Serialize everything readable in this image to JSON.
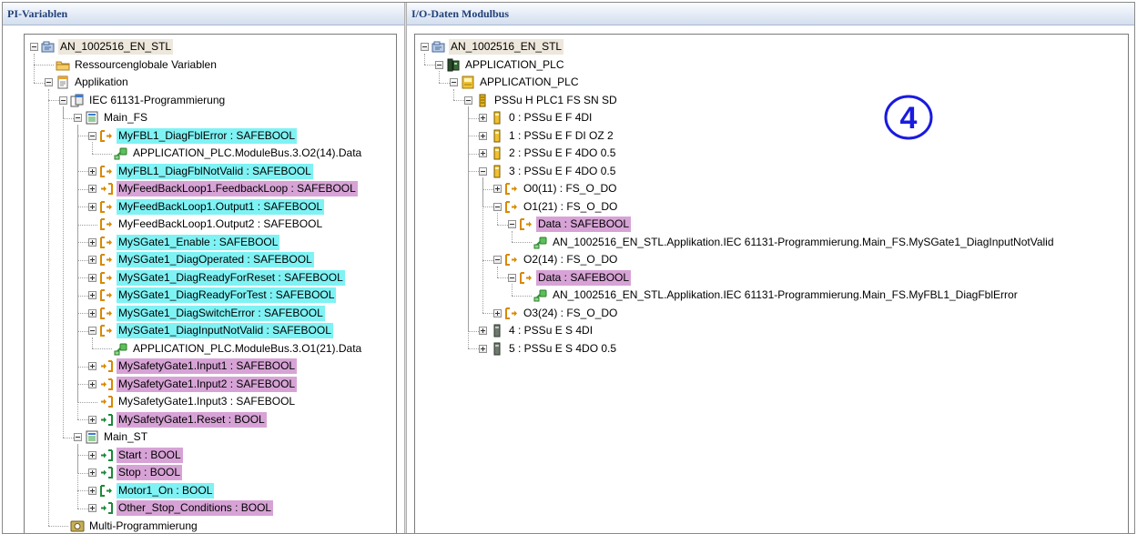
{
  "left_panel": {
    "title": "PI-Variablen",
    "tree": [
      {
        "label": "AN_1002516_EN_STL",
        "icon": "project-icon",
        "hl": "root",
        "exp": "minus"
      },
      {
        "label": "Ressourcenglobale Variablen",
        "icon": "folder-icon",
        "hl": "",
        "exp": "none"
      },
      {
        "label": "Applikation",
        "icon": "application-icon",
        "hl": "",
        "exp": "minus"
      },
      {
        "label": "IEC 61131-Programmierung",
        "icon": "program-group-icon",
        "hl": "",
        "exp": "minus"
      },
      {
        "label": "Main_FS",
        "icon": "program-icon",
        "hl": "",
        "exp": "minus"
      },
      {
        "label": "MyFBL1_DiagFblError : SAFEBOOL",
        "icon": "output-var-icon",
        "hl": "cyan",
        "exp": "minus"
      },
      {
        "label": "APPLICATION_PLC.ModuleBus.3.O2(14).Data",
        "icon": "link-icon",
        "hl": "",
        "exp": "none"
      },
      {
        "label": "MyFBL1_DiagFblNotValid : SAFEBOOL",
        "icon": "output-var-icon",
        "hl": "cyan",
        "exp": "plus"
      },
      {
        "label": "MyFeedBackLoop1.FeedbackLoop : SAFEBOOL",
        "icon": "input-var-icon",
        "hl": "mag",
        "exp": "plus"
      },
      {
        "label": "MyFeedBackLoop1.Output1 : SAFEBOOL",
        "icon": "output-var-icon",
        "hl": "cyan",
        "exp": "plus"
      },
      {
        "label": "MyFeedBackLoop1.Output2 : SAFEBOOL",
        "icon": "output-var-icon",
        "hl": "",
        "exp": "none"
      },
      {
        "label": "MySGate1_Enable : SAFEBOOL",
        "icon": "output-var-icon",
        "hl": "cyan",
        "exp": "plus"
      },
      {
        "label": "MySGate1_DiagOperated : SAFEBOOL",
        "icon": "output-var-icon",
        "hl": "cyan",
        "exp": "plus"
      },
      {
        "label": "MySGate1_DiagReadyForReset : SAFEBOOL",
        "icon": "output-var-icon",
        "hl": "cyan",
        "exp": "plus"
      },
      {
        "label": "MySGate1_DiagReadyForTest : SAFEBOOL",
        "icon": "output-var-icon",
        "hl": "cyan",
        "exp": "plus"
      },
      {
        "label": "MySGate1_DiagSwitchError : SAFEBOOL",
        "icon": "output-var-icon",
        "hl": "cyan",
        "exp": "plus"
      },
      {
        "label": "MySGate1_DiagInputNotValid : SAFEBOOL",
        "icon": "output-var-icon",
        "hl": "cyan",
        "exp": "minus"
      },
      {
        "label": "APPLICATION_PLC.ModuleBus.3.O1(21).Data",
        "icon": "link-icon",
        "hl": "",
        "exp": "none"
      },
      {
        "label": "MySafetyGate1.Input1 : SAFEBOOL",
        "icon": "input-var-icon",
        "hl": "mag",
        "exp": "plus"
      },
      {
        "label": "MySafetyGate1.Input2 : SAFEBOOL",
        "icon": "input-var-icon",
        "hl": "mag",
        "exp": "plus"
      },
      {
        "label": "MySafetyGate1.Input3 : SAFEBOOL",
        "icon": "input-var-icon",
        "hl": "",
        "exp": "none"
      },
      {
        "label": "MySafetyGate1.Reset : BOOL",
        "icon": "input-var-std-icon",
        "hl": "mag",
        "exp": "plus"
      },
      {
        "label": "Main_ST",
        "icon": "program-icon",
        "hl": "",
        "exp": "minus"
      },
      {
        "label": "Start : BOOL",
        "icon": "input-var-std-icon",
        "hl": "mag",
        "exp": "plus"
      },
      {
        "label": "Stop : BOOL",
        "icon": "input-var-std-icon",
        "hl": "mag",
        "exp": "plus"
      },
      {
        "label": "Motor1_On : BOOL",
        "icon": "output-var-std-icon",
        "hl": "cyan",
        "exp": "plus"
      },
      {
        "label": "Other_Stop_Conditions : BOOL",
        "icon": "input-var-std-icon",
        "hl": "mag",
        "exp": "plus"
      },
      {
        "label": "Multi-Programmierung",
        "icon": "multi-program-icon",
        "hl": "",
        "exp": "none"
      }
    ]
  },
  "right_panel": {
    "title": "I/O-Daten Modulbus",
    "badge": "4",
    "tree": [
      {
        "label": "AN_1002516_EN_STL",
        "icon": "project-icon",
        "hl": "root",
        "exp": "minus"
      },
      {
        "label": "APPLICATION_PLC",
        "icon": "plc-icon",
        "hl": "",
        "exp": "minus"
      },
      {
        "label": "APPLICATION_PLC",
        "icon": "plc-app-icon",
        "hl": "",
        "exp": "minus"
      },
      {
        "label": "PSSu H PLC1 FS SN SD",
        "icon": "head-module-icon",
        "hl": "",
        "exp": "minus"
      },
      {
        "label": "0 : PSSu E F 4DI",
        "icon": "safe-module-icon",
        "hl": "",
        "exp": "plus"
      },
      {
        "label": "1 : PSSu E F DI OZ 2",
        "icon": "safe-module-icon",
        "hl": "",
        "exp": "plus"
      },
      {
        "label": "2 : PSSu E F 4DO 0.5",
        "icon": "safe-module-icon",
        "hl": "",
        "exp": "plus"
      },
      {
        "label": "3 : PSSu E F 4DO 0.5",
        "icon": "safe-module-icon",
        "hl": "",
        "exp": "minus"
      },
      {
        "label": "O0(11) : FS_O_DO",
        "icon": "output-var-icon",
        "hl": "",
        "exp": "plus"
      },
      {
        "label": "O1(21) : FS_O_DO",
        "icon": "output-var-icon",
        "hl": "",
        "exp": "minus"
      },
      {
        "label": "Data : SAFEBOOL",
        "icon": "output-var-icon",
        "hl": "mag",
        "exp": "minus"
      },
      {
        "label": "AN_1002516_EN_STL.Applikation.IEC 61131-Programmierung.Main_FS.MySGate1_DiagInputNotValid",
        "icon": "link-icon",
        "hl": "",
        "exp": "none"
      },
      {
        "label": "O2(14) : FS_O_DO",
        "icon": "output-var-icon",
        "hl": "",
        "exp": "minus"
      },
      {
        "label": "Data : SAFEBOOL",
        "icon": "output-var-icon",
        "hl": "mag",
        "exp": "minus"
      },
      {
        "label": "AN_1002516_EN_STL.Applikation.IEC 61131-Programmierung.Main_FS.MyFBL1_DiagFblError",
        "icon": "link-icon",
        "hl": "",
        "exp": "none"
      },
      {
        "label": "O3(24) : FS_O_DO",
        "icon": "output-var-icon",
        "hl": "",
        "exp": "plus"
      },
      {
        "label": "4 : PSSu E S 4DI",
        "icon": "std-module-icon",
        "hl": "",
        "exp": "plus"
      },
      {
        "label": "5 : PSSu E S 4DO 0.5",
        "icon": "std-module-icon",
        "hl": "",
        "exp": "plus"
      }
    ]
  },
  "colors": {
    "highlight_cyan": "#7ff2f4",
    "highlight_magenta": "#d7a3d6",
    "header_text": "#1f3f78",
    "badge_blue": "#1a1ae0"
  }
}
